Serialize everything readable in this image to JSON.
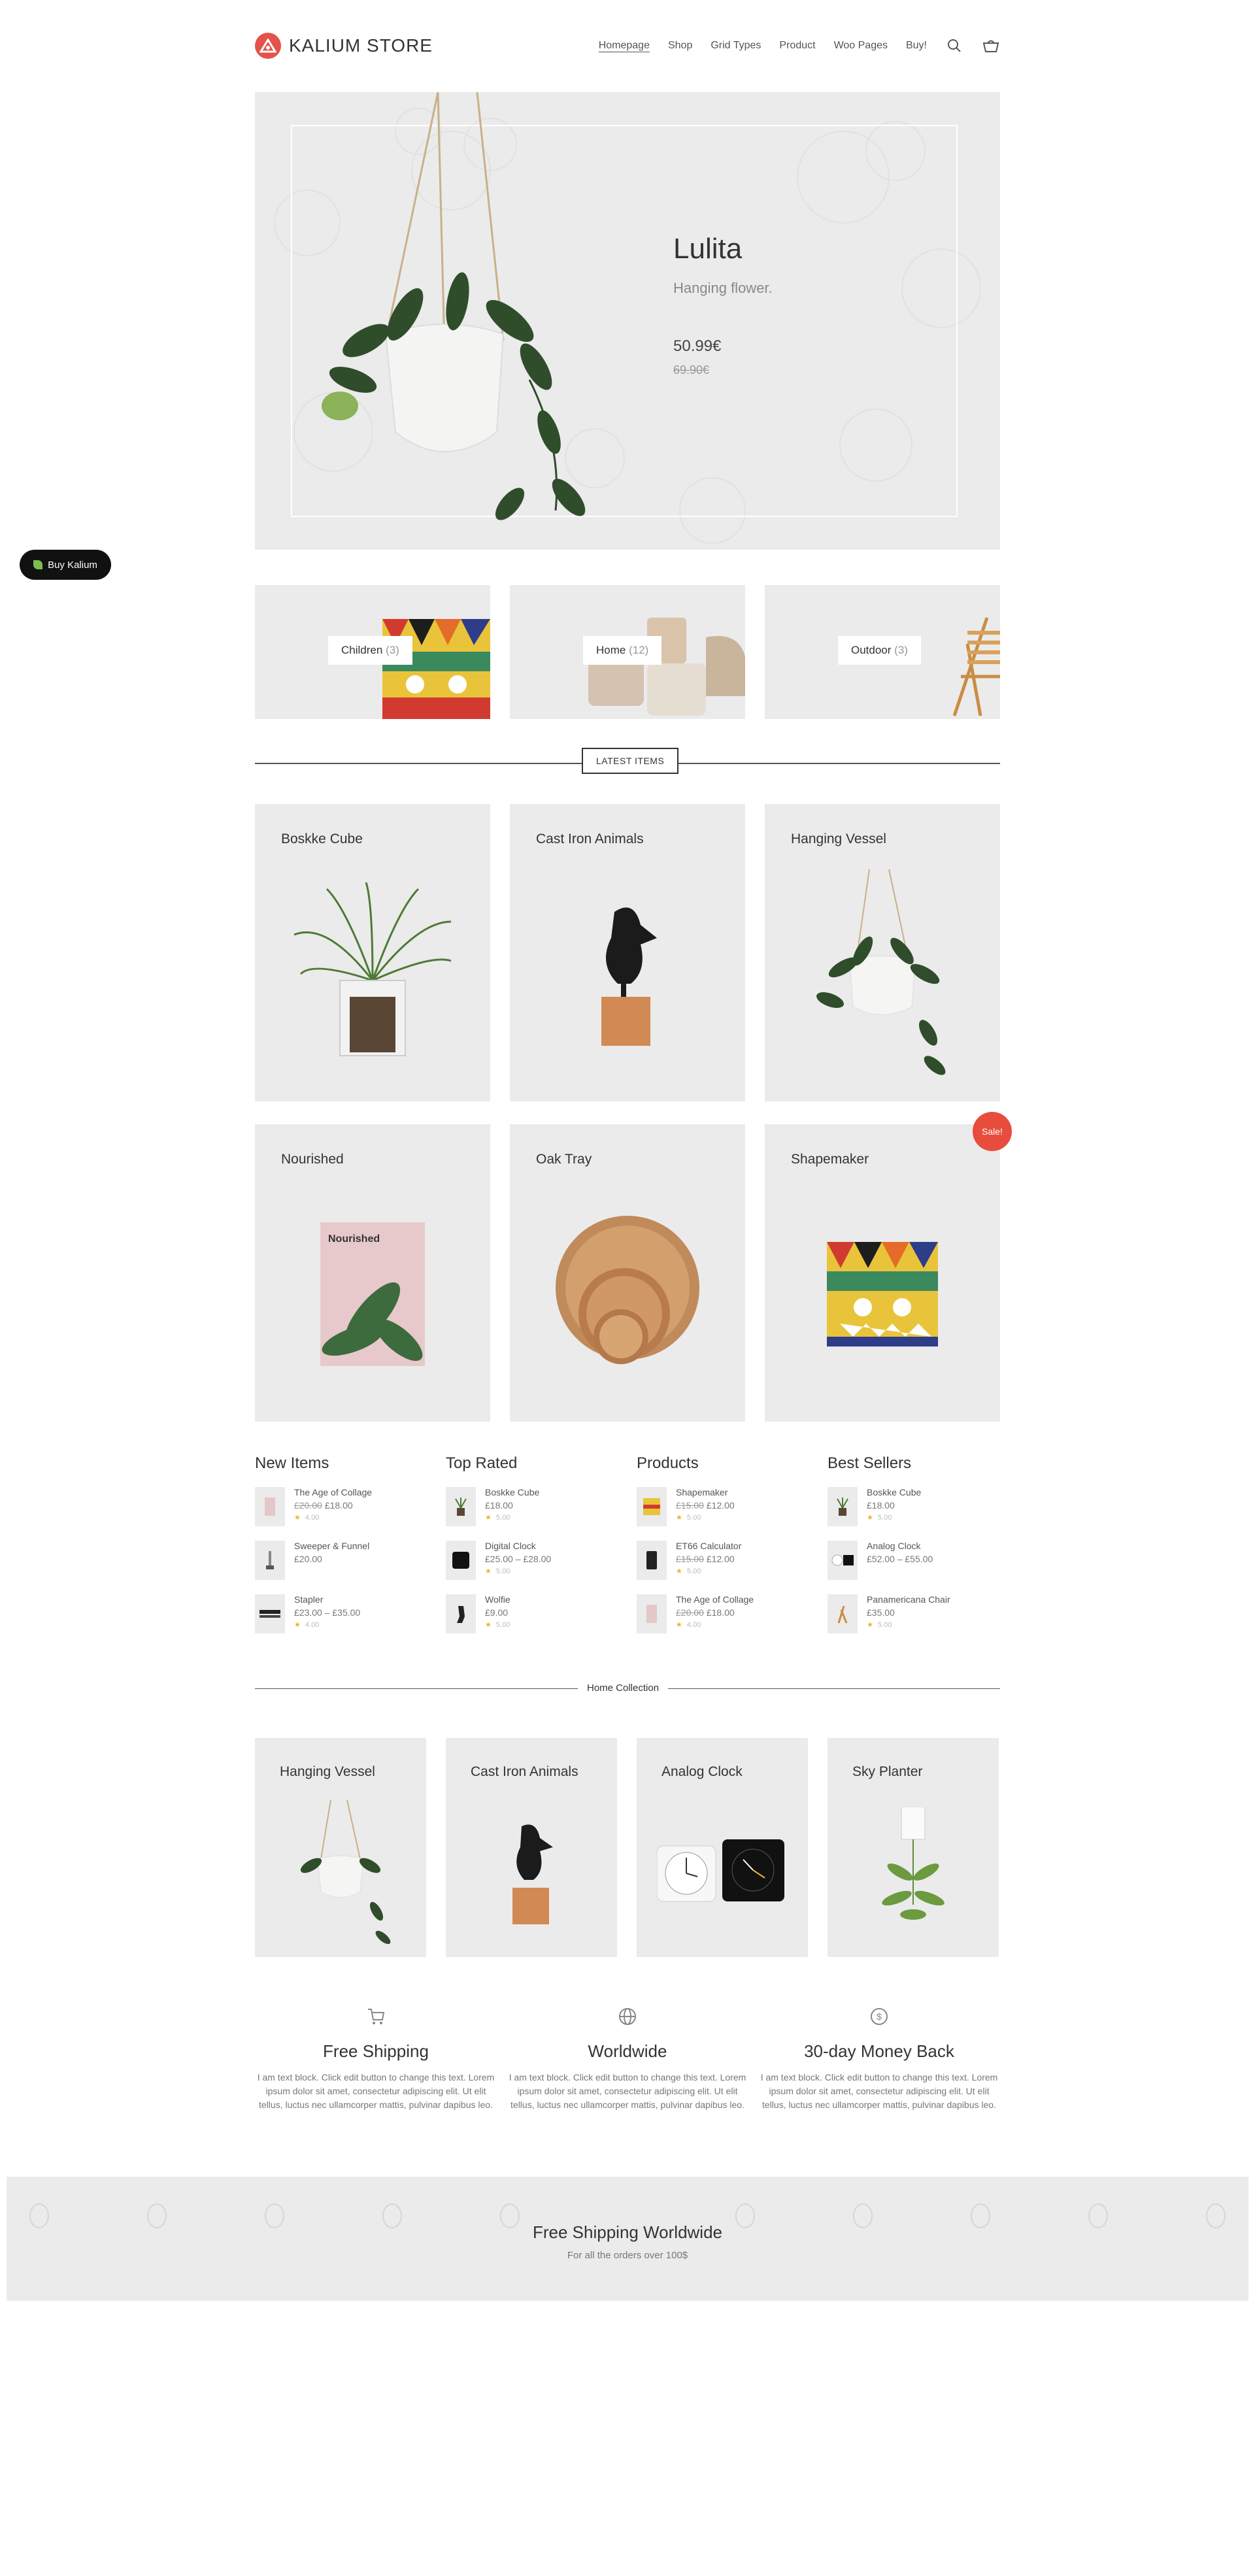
{
  "brand": {
    "name": "KALIUM STORE",
    "accent": "#e4524a"
  },
  "nav": {
    "items": [
      "Homepage",
      "Shop",
      "Grid Types",
      "Product",
      "Woo Pages",
      "Buy!"
    ],
    "search_icon": "search-icon",
    "cart_icon": "basket-icon"
  },
  "hero": {
    "title": "Lulita",
    "subtitle": "Hanging flower.",
    "price": "50.99€",
    "old_price": "69.90€"
  },
  "buy_pill": {
    "label": "Buy Kalium"
  },
  "categories": [
    {
      "name": "Children",
      "count": "(3)"
    },
    {
      "name": "Home",
      "count": "(12)"
    },
    {
      "name": "Outdoor",
      "count": "(3)"
    }
  ],
  "latest": {
    "label": "LATEST ITEMS",
    "products": [
      "Boskke Cube",
      "Cast Iron Animals",
      "Hanging Vessel",
      "Nourished",
      "Oak Tray",
      "Shapemaker"
    ],
    "sale_badge": "Sale!",
    "nourished_cover": "Nourished"
  },
  "widgets": [
    {
      "title": "New Items",
      "items": [
        {
          "name": "The Age of Collage",
          "old": "£20.00",
          "price": "£18.00",
          "rating": "4.00"
        },
        {
          "name": "Sweeper & Funnel",
          "old": "",
          "price": "£20.00",
          "rating": ""
        },
        {
          "name": "Stapler",
          "old": "",
          "price": "£23.00 – £35.00",
          "rating": "4.00"
        }
      ]
    },
    {
      "title": "Top Rated",
      "items": [
        {
          "name": "Boskke Cube",
          "old": "",
          "price": "£18.00",
          "rating": "5.00"
        },
        {
          "name": "Digital Clock",
          "old": "",
          "price": "£25.00 – £28.00",
          "rating": "5.00"
        },
        {
          "name": "Wolfie",
          "old": "",
          "price": "£9.00",
          "rating": "5.00"
        }
      ]
    },
    {
      "title": "Products",
      "items": [
        {
          "name": "Shapemaker",
          "old": "£15.00",
          "price": "£12.00",
          "rating": "5.00"
        },
        {
          "name": "ET66 Calculator",
          "old": "£15.00",
          "price": "£12.00",
          "rating": "5.00"
        },
        {
          "name": "The Age of Collage",
          "old": "£20.00",
          "price": "£18.00",
          "rating": "4.00"
        }
      ]
    },
    {
      "title": "Best Sellers",
      "items": [
        {
          "name": "Boskke Cube",
          "old": "",
          "price": "£18.00",
          "rating": "5.00"
        },
        {
          "name": "Analog Clock",
          "old": "",
          "price": "£52.00 – £55.00",
          "rating": ""
        },
        {
          "name": "Panamericana Chair",
          "old": "",
          "price": "£35.00",
          "rating": "5.00"
        }
      ]
    }
  ],
  "home_collection": {
    "label": "Home Collection",
    "products": [
      "Hanging Vessel",
      "Cast Iron Animals",
      "Analog Clock",
      "Sky Planter"
    ]
  },
  "features": [
    {
      "icon": "shopping-cart-icon",
      "title": "Free Shipping",
      "text": "I am text block. Click edit button to change this text. Lorem ipsum dolor sit amet, consectetur adipiscing elit. Ut elit tellus, luctus nec ullamcorper mattis, pulvinar dapibus leo."
    },
    {
      "icon": "globe-icon",
      "title": "Worldwide",
      "text": "I am text block. Click edit button to change this text. Lorem ipsum dolor sit amet, consectetur adipiscing elit. Ut elit tellus, luctus nec ullamcorper mattis, pulvinar dapibus leo."
    },
    {
      "icon": "dollar-icon",
      "title": "30-day Money Back",
      "text": "I am text block. Click edit button to change this text. Lorem ipsum dolor sit amet, consectetur adipiscing elit. Ut elit tellus, luctus nec ullamcorper mattis, pulvinar dapibus leo."
    }
  ],
  "banner": {
    "title": "Free Shipping Worldwide",
    "subtitle": "For all the orders over 100$"
  }
}
